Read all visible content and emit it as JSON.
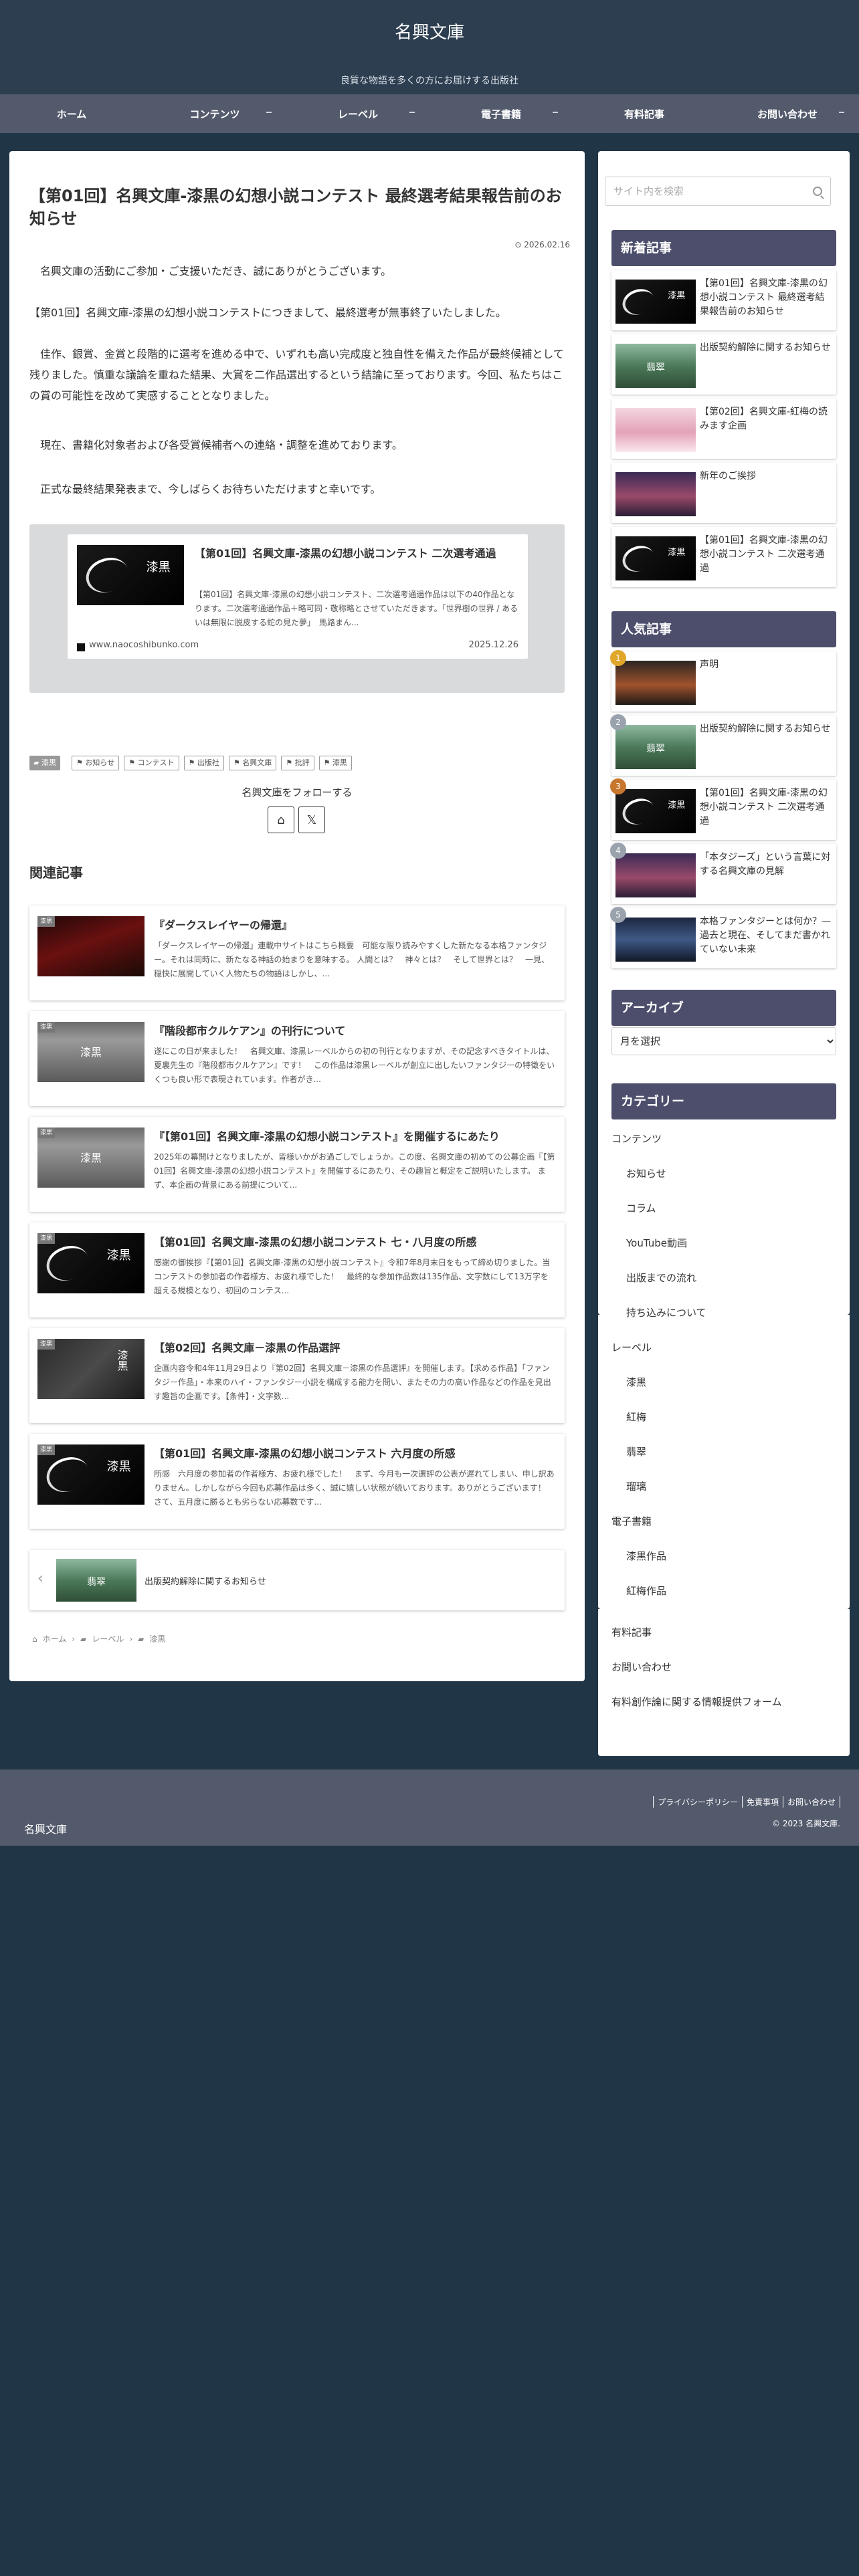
{
  "site": {
    "name": "名興文庫",
    "tagline": "良質な物語を多くの方にお届けする出版社"
  },
  "nav": [
    {
      "label": "ホーム",
      "has_children": false
    },
    {
      "label": "コンテンツ",
      "has_children": true
    },
    {
      "label": "レーベル",
      "has_children": true
    },
    {
      "label": "電子書籍",
      "has_children": true
    },
    {
      "label": "有料記事",
      "has_children": false
    },
    {
      "label": "お問い合わせ",
      "has_children": true
    }
  ],
  "post": {
    "title": "【第01回】名興文庫-漆黒の幻想小説コンテスト 最終選考結果報告前のお知らせ",
    "date": "2026.02.16",
    "paragraphs": [
      "名興文庫の活動にご参加・ご支援いただき、誠にありがとうございます。",
      "【第01回】名興文庫-漆黒の幻想小説コンテストにつきまして、最終選考が無事終了いたしました。",
      "佳作、銀賞、金賞と段階的に選考を進める中で、いずれも高い完成度と独自性を備えた作品が最終候補として残りました。慎重な議論を重ねた結果、大賞を二作品選出するという結論に至っております。今回、私たちはこの賞の可能性を改めて実感することとなりました。",
      "現在、書籍化対象者および各受賞候補者への連絡・調整を進めております。",
      "正式な最終結果発表まで、今しばらくお待ちいただけますと幸いです。"
    ],
    "blogcard": {
      "title": "【第01回】名興文庫-漆黒の幻想小説コンテスト 二次選考通過",
      "excerpt": "【第01回】名興文庫-漆黒の幻想小説コンテスト、二次選考通過作品は以下の40作品となります。二次選考通過作品＋略可同・敬称略とさせていただきます。「世界樹の世界 / あるいは無限に脱皮する蛇の見た夢」　馬路まん...",
      "site": "www.naocoshibunko.com",
      "date": "2025.12.26",
      "thumb_text": "漆黒"
    },
    "category": "漆黒",
    "tags": [
      "お知らせ",
      "コンテスト",
      "出版社",
      "名興文庫",
      "批評",
      "漆黒"
    ],
    "follow_label": "名興文庫をフォローする"
  },
  "related": {
    "heading": "関連記事",
    "items": [
      {
        "label": "漆黒",
        "title": "『ダークスレイヤーの帰還』",
        "excerpt": "「ダークスレイヤーの帰還」連載中サイトはこちら概要　可能な限り読みやすくした新たなる本格ファンタジー。それは同時に、新たなる神話の始まりを意味する。 人間とは？　神々とは？　そして世界とは？　一見、穏快に展開していく人物たちの物語はしかし、...",
        "thumb": "dark"
      },
      {
        "label": "漆黒",
        "title": "『階段都市クルケアン』の刊行について",
        "excerpt": "遂にこの日が来ました！　名興文庫、漆黒レーベルからの初の刊行となりますが、その記念すべきタイトルは、夏裏先生の『階段都市クルケアン』です！　この作品は漆黒レーベルが創立に出したいファンタジーの特徴をいくつも良い形で表現されています。作者がき...",
        "thumb": "gray",
        "thumb_text": "漆黒"
      },
      {
        "label": "漆黒",
        "title": "『【第01回】名興文庫-漆黒の幻想小説コンテスト』を開催するにあたり",
        "excerpt": "2025年の幕開けとなりましたが、皆様いかがお過ごしでしょうか。この度、名興文庫の初めての公募企画『【第01回】名興文庫-漆黒の幻想小説コンテスト』を開催するにあたり、その趣旨と概定をご説明いたします。 まず、本企画の背景にある前提について...",
        "thumb": "gray",
        "thumb_text": "漆黒"
      },
      {
        "label": "漆黒",
        "title": "【第01回】名興文庫-漆黒の幻想小説コンテスト 七・八月度の所感",
        "excerpt": "感謝の御挨拶『【第01回】名興文庫-漆黒の幻想小説コンテスト』令和7年8月末日をもって締め切りました。当コンテストの参加者の作者様方、お疲れ様でした！　最終的な参加作品数は135作品、文字数にして13万字を超える規模となり、初回のコンテス...",
        "thumb": "sikkoku",
        "thumb_text": "漆黒"
      },
      {
        "label": "漆黒",
        "title": "【第02回】名興文庫－漆黒の作品選評",
        "excerpt": "企画内容令和4年11月29日より『第02回】名興文庫－漆黒の作品選評』を開催します。【求める作品】「ファンタジー作品」・本来のハイ・ファンタジー小説を構成する能力を問い、またその力の高い作品などの作品を見出す趣旨の企画です。【条件】・文字数...",
        "thumb": "blackstone",
        "thumb_text": "漆黒"
      },
      {
        "label": "漆黒",
        "title": "【第01回】名興文庫-漆黒の幻想小説コンテスト 六月度の所感",
        "excerpt": "所感　六月度の参加者の作者様方、お疲れ様でした！　まず、今月も一次選評の公表が遅れてしまい、申し訳ありません。しかしながら今回も応募作品は多く、誠に嬉しい状態が続いております。ありがとうございます！　さて、五月度に勝るとも劣らない応募数です...",
        "thumb": "sikkoku",
        "thumb_text": "漆黒"
      }
    ]
  },
  "pager": {
    "prev_title": "出版契約解除に関するお知らせ",
    "thumb_text": "翡翠"
  },
  "breadcrumb": [
    "ホーム",
    "レーベル",
    "漆黒"
  ],
  "sidebar": {
    "search_placeholder": "サイト内を検索",
    "new_title": "新着記事",
    "new_items": [
      {
        "title": "【第01回】名興文庫-漆黒の幻想小説コンテスト 最終選考結果報告前のお知らせ",
        "thumb": "sikkoku",
        "thumb_text": "漆黒"
      },
      {
        "title": "出版契約解除に関するお知らせ",
        "thumb": "forest",
        "thumb_text": "翡翠"
      },
      {
        "title": "【第02回】名興文庫-紅梅の読みます企画",
        "thumb": "pink"
      },
      {
        "title": "新年のご挨拶",
        "thumb": "dusk"
      },
      {
        "title": "【第01回】名興文庫-漆黒の幻想小説コンテスト 二次選考通過",
        "thumb": "sikkoku",
        "thumb_text": "漆黒"
      }
    ],
    "popular_title": "人気記事",
    "popular_items": [
      {
        "rank": "1",
        "title": "声明",
        "thumb": "sunset"
      },
      {
        "rank": "2",
        "title": "出版契約解除に関するお知らせ",
        "thumb": "forest",
        "thumb_text": "翡翠"
      },
      {
        "rank": "3",
        "title": "【第01回】名興文庫-漆黒の幻想小説コンテスト 二次選考通過",
        "thumb": "sikkoku",
        "thumb_text": "漆黒"
      },
      {
        "rank": "4",
        "title": "「本タジーズ」という言葉に対する名興文庫の見解",
        "thumb": "dusk"
      },
      {
        "rank": "5",
        "title": "本格ファンタジーとは何か？—過去と現在、そしてまだ書かれていない未来",
        "thumb": "night"
      }
    ],
    "archive_title": "アーカイブ",
    "archive_select": "月を選択",
    "category_title": "カテゴリー",
    "categories": [
      {
        "label": "コンテンツ",
        "sub": false
      },
      {
        "label": "お知らせ",
        "sub": true
      },
      {
        "label": "コラム",
        "sub": true
      },
      {
        "label": "YouTube動画",
        "sub": true
      },
      {
        "label": "出版までの流れ",
        "sub": true
      },
      {
        "label": "持ち込みについて",
        "sub": true
      },
      {
        "label": "レーベル",
        "sub": false
      },
      {
        "label": "漆黒",
        "sub": true
      },
      {
        "label": "紅梅",
        "sub": true
      },
      {
        "label": "翡翠",
        "sub": true
      },
      {
        "label": "瑠璃",
        "sub": true
      },
      {
        "label": "電子書籍",
        "sub": false
      },
      {
        "label": "漆黒作品",
        "sub": true
      },
      {
        "label": "紅梅作品",
        "sub": true
      },
      {
        "label": "有料記事",
        "sub": false
      },
      {
        "label": "お問い合わせ",
        "sub": false
      },
      {
        "label": "有料創作論に関する情報提供フォーム",
        "sub": false
      }
    ]
  },
  "footer": {
    "logo": "名興文庫",
    "links": [
      "プライバシーポリシー",
      "免責事項",
      "お問い合わせ"
    ],
    "copyright": "© 2023 名興文庫."
  },
  "colors": {
    "header_bg": "#2c3e50",
    "nav_bg": "#535a6c",
    "page_bg": "#203545",
    "widget_title_bg": "#4c4e6c",
    "rank_1": "#e0a72b",
    "rank_2": "#9aa3ad",
    "rank_3": "#c8772e",
    "rank_4": "#9aa3ad",
    "rank_5": "#9aa3ad"
  }
}
